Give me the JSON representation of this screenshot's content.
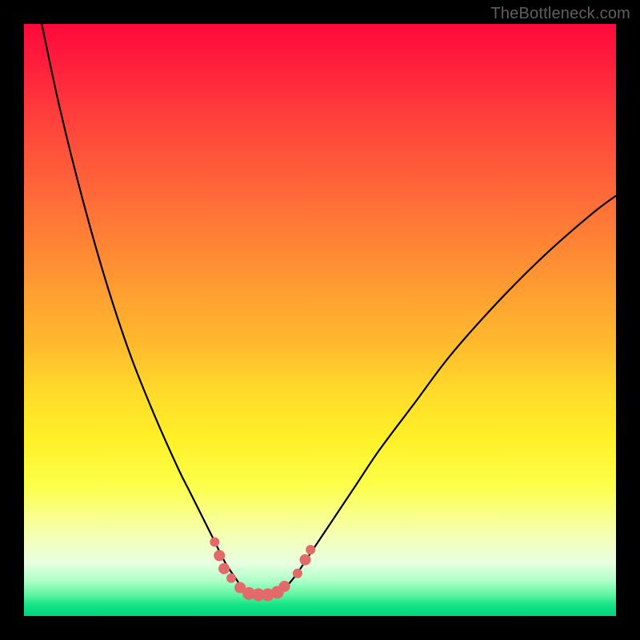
{
  "watermark": "TheBottleneck.com",
  "colors": {
    "frame": "#000000",
    "curve_stroke": "#000000",
    "marker_fill": "#e26a6a",
    "marker_stroke": "#c84f4f"
  },
  "chart_data": {
    "type": "line",
    "title": "",
    "xlabel": "",
    "ylabel": "",
    "xlim": [
      0,
      100
    ],
    "ylim": [
      0,
      100
    ],
    "grid": false,
    "legend": false,
    "note": "Y is the vertical position of the curve as a percentage of the plot height measured from the TOP (0 = top edge, 100 = bottom edge). Values estimated from pixels; chart has no numeric axes.",
    "series": [
      {
        "name": "curve",
        "x": [
          3,
          6,
          10,
          14,
          18,
          22,
          26,
          28,
          30,
          32,
          34,
          36,
          37,
          38.5,
          40,
          42,
          44,
          46,
          48,
          52,
          56,
          60,
          66,
          72,
          80,
          88,
          96,
          100
        ],
        "y": [
          0,
          14,
          30,
          44,
          56,
          66,
          75,
          79,
          83,
          87,
          91,
          94,
          95.5,
          96.3,
          96.3,
          96.3,
          95.3,
          93,
          90,
          84,
          78,
          72,
          64,
          56,
          47,
          39,
          32,
          29
        ]
      }
    ],
    "markers": {
      "note": "Salmon pill/bead markers drawn on the curve near its minimum. x,y in same 0–100 space as the curve; r is radius in px at 740px plot size.",
      "points": [
        {
          "x": 32.2,
          "y": 87.5,
          "r": 6
        },
        {
          "x": 33.0,
          "y": 89.8,
          "r": 7
        },
        {
          "x": 33.8,
          "y": 92.0,
          "r": 7
        },
        {
          "x": 35.0,
          "y": 93.6,
          "r": 6
        },
        {
          "x": 36.5,
          "y": 95.2,
          "r": 7
        },
        {
          "x": 38.0,
          "y": 96.2,
          "r": 8
        },
        {
          "x": 39.6,
          "y": 96.4,
          "r": 8
        },
        {
          "x": 41.2,
          "y": 96.4,
          "r": 8
        },
        {
          "x": 42.8,
          "y": 96.0,
          "r": 8
        },
        {
          "x": 44.0,
          "y": 95.0,
          "r": 7
        },
        {
          "x": 46.2,
          "y": 92.8,
          "r": 6
        },
        {
          "x": 47.5,
          "y": 90.5,
          "r": 7
        },
        {
          "x": 48.4,
          "y": 88.8,
          "r": 6
        }
      ]
    }
  }
}
